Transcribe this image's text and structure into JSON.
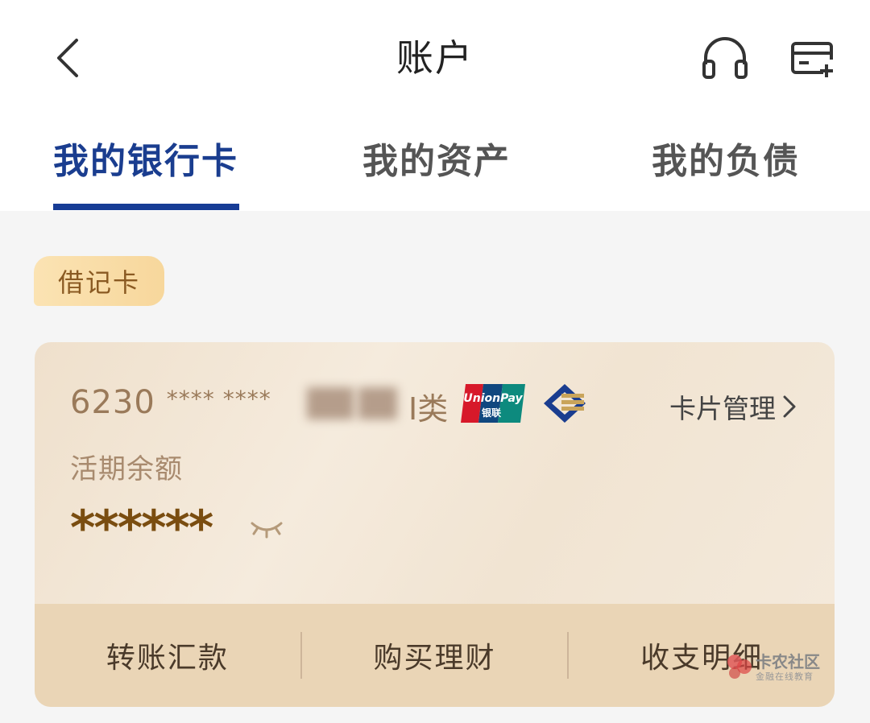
{
  "header": {
    "title": "账户",
    "back_icon": "chevron-left-icon",
    "headset_icon": "headset-icon",
    "add_card_icon": "add-card-icon"
  },
  "tabs": [
    {
      "label": "我的银行卡",
      "active": true
    },
    {
      "label": "我的资产",
      "active": false
    },
    {
      "label": "我的负债",
      "active": false
    }
  ],
  "card_type_badge": "借记卡",
  "card": {
    "number_prefix": "6230",
    "number_masked": "**** ****",
    "class_label": "I类",
    "network_logo_text": "UnionPay",
    "network_logo_subtext": "银联",
    "manage_label": "卡片管理",
    "balance_label": "活期余额",
    "balance_value": "******",
    "eye_icon": "eye-closed-icon"
  },
  "actions": [
    {
      "label": "转账汇款"
    },
    {
      "label": "购买理财"
    },
    {
      "label": "收支明细"
    }
  ],
  "watermark": {
    "title": "卡农社区",
    "subtitle": "金融在线教育"
  },
  "colors": {
    "accent": "#173c95",
    "card_bg": "#f2e6d6",
    "action_bar": "#ead5b6",
    "balance": "#7a4d10"
  }
}
